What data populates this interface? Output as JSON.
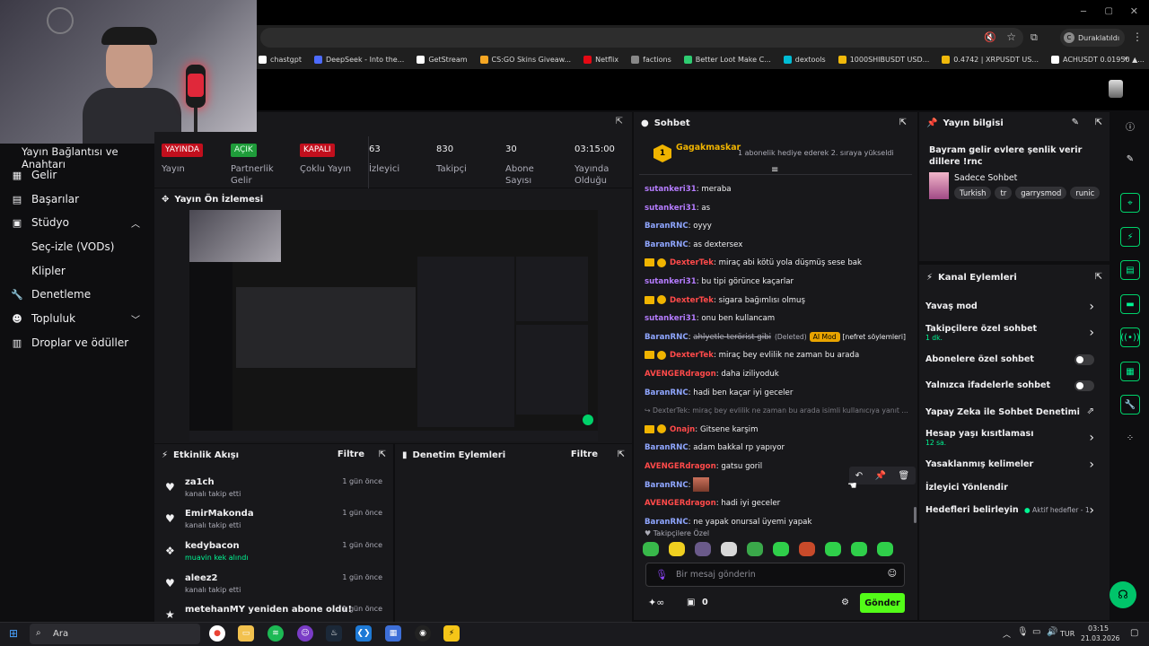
{
  "browser": {
    "user_chip": "Duraklatıldı",
    "bookmarks": [
      {
        "label": "chastgpt",
        "color": "#ffffff"
      },
      {
        "label": "DeepSeek - Into the...",
        "color": "#4d6bfe"
      },
      {
        "label": "GetStream",
        "color": "#ffffff"
      },
      {
        "label": "CS:GO Skins Giveaw...",
        "color": "#f5a623"
      },
      {
        "label": "Netflix",
        "color": "#e50914"
      },
      {
        "label": "factions",
        "color": "#888888"
      },
      {
        "label": "Better Loot Make C...",
        "color": "#2ecc71"
      },
      {
        "label": "dextools",
        "color": "#00bcd4"
      },
      {
        "label": "1000SHIBUSDT USD...",
        "color": "#f0b90b"
      },
      {
        "label": "0.4742 | XRPUSDT US...",
        "color": "#f0b90b"
      },
      {
        "label": "ACHUSDT 0.01950 ▲...",
        "color": "#ffffff"
      }
    ]
  },
  "sidebar": {
    "header": "Yayın Bağlantısı ve Anahtarı",
    "items": [
      {
        "label": "Gelir",
        "icon": "revenue-icon"
      },
      {
        "label": "Başarılar",
        "icon": "achievements-icon"
      },
      {
        "label": "Stüdyo",
        "icon": "studio-icon",
        "expanded": true
      },
      {
        "label": "Seç-izle (VODs)",
        "sub": true
      },
      {
        "label": "Klipler",
        "sub": true
      },
      {
        "label": "Denetleme",
        "icon": "wrench-icon"
      },
      {
        "label": "Topluluk",
        "icon": "community-icon",
        "collapsed": true
      },
      {
        "label": "Droplar ve ödüller",
        "icon": "drops-icon"
      }
    ]
  },
  "stats": [
    {
      "value": "YAYINDA",
      "label": "Yayın",
      "kind": "red"
    },
    {
      "value": "AÇIK",
      "label": "Partnerlik Gelir",
      "kind": "green"
    },
    {
      "value": "KAPALI",
      "label": "Çoklu Yayın",
      "kind": "red"
    },
    {
      "value": "63",
      "label": "İzleyici",
      "kind": "text"
    },
    {
      "value": "830",
      "label": "Takipçi",
      "kind": "text"
    },
    {
      "value": "30",
      "label": "Abone Sayısı",
      "kind": "text"
    },
    {
      "value": "03:15:00",
      "label": "Yayında Olduğu",
      "kind": "text"
    }
  ],
  "preview": {
    "title": "Yayın Ön İzlemesi"
  },
  "activity": {
    "title": "Etkinlik Akışı",
    "filter": "Filtre",
    "items": [
      {
        "name": "za1ch",
        "desc": "kanalı takip etti",
        "time": "1 gün önce",
        "desc_color": "#adadb8"
      },
      {
        "name": "EmirMakonda",
        "desc": "kanalı takip etti",
        "time": "1 gün önce",
        "desc_color": "#adadb8"
      },
      {
        "name": "kedybacon",
        "desc": "muavin kek alındı",
        "time": "1 gün önce",
        "desc_color": "#00f593"
      },
      {
        "name": "aleez2",
        "desc": "kanalı takip etti",
        "time": "1 gün önce",
        "desc_color": "#adadb8"
      },
      {
        "name": "metehanMY yeniden abone oldu!",
        "desc": "",
        "time": "1 gün önce",
        "desc_color": "#adadb8"
      }
    ]
  },
  "moderation": {
    "title": "Denetim Eylemleri",
    "filter": "Filtre"
  },
  "chat": {
    "title": "Sohbet",
    "pinned": {
      "user": "Gagakmaskar",
      "badge": "1",
      "text": "1 abonelik hediye ederek 2. sıraya yükseldi"
    },
    "messages": [
      {
        "user": "sutankeri31",
        "color": "purple",
        "text": "meraba"
      },
      {
        "user": "sutankeri31",
        "color": "purple",
        "text": "as"
      },
      {
        "user": "BaranRNC",
        "color": "blue",
        "text": "oyyy"
      },
      {
        "user": "BaranRNC",
        "color": "blue",
        "text": "as dextersex"
      },
      {
        "user": "DexterTek",
        "color": "red",
        "badges": true,
        "text": "miraç abi kötü yola düşmüş sese bak"
      },
      {
        "user": "sutankeri31",
        "color": "purple",
        "text": "bu tipi görünce kaçarlar"
      },
      {
        "user": "DexterTek",
        "color": "red",
        "badges": true,
        "text": "sigara bağımlısı olmuş"
      },
      {
        "user": "sutankeri31",
        "color": "purple",
        "text": "onu ben kullancam"
      },
      {
        "user": "BaranRNC",
        "color": "blue",
        "text": "ahlyetle terörist gibi",
        "deleted": "(Deleted)",
        "mod": "AI Mod",
        "reason": "[nefret söylemleri]"
      },
      {
        "user": "DexterTek",
        "color": "red",
        "badges": true,
        "text": "miraç bey evlilik ne zaman bu arada"
      },
      {
        "user": "AVENGERdragon",
        "color": "red",
        "text": "daha iziliyoduk"
      },
      {
        "user": "BaranRNC",
        "color": "blue",
        "text": "hadi ben kaçar iyi geceler"
      },
      {
        "reply": "↪ DexterTek: miraç bey evlilik ne zaman bu arada isimli kullanıcıya yanıt ..."
      },
      {
        "user": "Onajn",
        "color": "red",
        "badges": true,
        "text": "Gitsene karşim"
      },
      {
        "user": "BaranRNC",
        "color": "blue",
        "text": "adam bakkal rp yapıyor"
      },
      {
        "user": "AVENGERdragon",
        "color": "red",
        "text": "gatsu goril"
      },
      {
        "user": "BaranRNC",
        "color": "blue",
        "text": "",
        "emote": true
      },
      {
        "user": "AVENGERdragon",
        "color": "red",
        "text": "hadi iyi geceler"
      },
      {
        "user": "BaranRNC",
        "color": "blue",
        "text": "ne yapak onursal üyemi yapak"
      }
    ],
    "emote_label": "♥ Takipçilere Özel",
    "input_placeholder": "Bir mesaj gönderin",
    "points": "0",
    "send": "Gönder"
  },
  "stream_info": {
    "title": "Yayın bilgisi",
    "stream_title": "Bayram gelir evlere şenlik verir dillere !rnc",
    "category": "Sadece Sohbet",
    "tags": [
      "Turkish",
      "tr",
      "garrysmod",
      "runic"
    ]
  },
  "channel_actions": {
    "title": "Kanal Eylemleri",
    "items": [
      {
        "label": "Yavaş mod",
        "control": "chevron"
      },
      {
        "label": "Takipçilere özel sohbet",
        "sub": "1 dk.",
        "control": "chevron"
      },
      {
        "label": "Abonelere özel sohbet",
        "control": "toggle"
      },
      {
        "label": "Yalnızca ifadelerle sohbet",
        "control": "toggle"
      },
      {
        "label": "Yapay Zeka ile Sohbet Denetimi",
        "control": "external"
      },
      {
        "label": "Hesap yaşı kısıtlaması",
        "sub": "12 sa.",
        "control": "chevron"
      },
      {
        "label": "Yasaklanmış kelimeler",
        "control": "chevron"
      },
      {
        "label": "İzleyici Yönlendir",
        "control": "none"
      },
      {
        "label": "Hedefleri belirleyin",
        "control": "chevron",
        "extra": "Aktif hedefler - 1"
      }
    ]
  },
  "taskbar": {
    "search": "Ara",
    "lang": "TUR",
    "time": "03:15",
    "date": "21.03.2026"
  }
}
